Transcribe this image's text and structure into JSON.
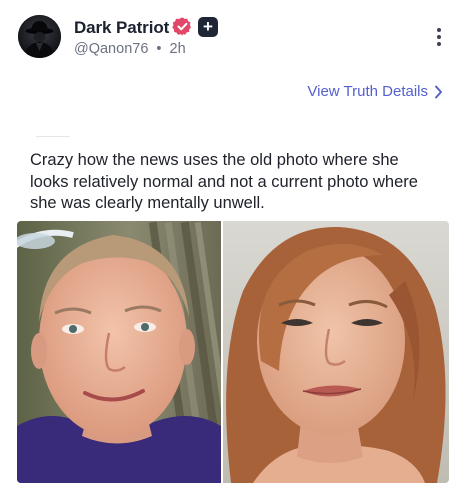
{
  "post": {
    "author": {
      "display_name": "Dark Patriot",
      "handle": "@Qanon76",
      "separator": "•",
      "time": "2h",
      "avatar_icon": "hooded-figure-avatar",
      "verified_icon": "verified-badge-icon",
      "plus_badge": "+"
    },
    "more_icon": "more-vertical-icon",
    "view_details_label": "View Truth Details",
    "view_details_icon": "chevron-right-icon",
    "caption": "Crazy how the news uses the old photo where she looks relatively normal and not a current photo where she was clearly mentally unwell.",
    "media": {
      "type": "image",
      "description_icon": "side-by-side-photo"
    }
  },
  "colors": {
    "link": "#5460cc",
    "verified": "#e2476a",
    "text": "#20232b",
    "muted": "#6b7180"
  }
}
